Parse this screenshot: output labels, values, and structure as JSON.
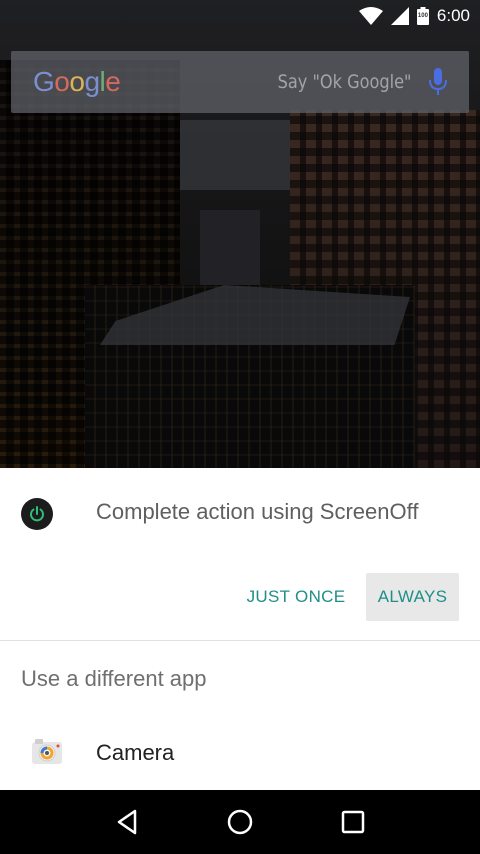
{
  "status_bar": {
    "time": "6:00",
    "battery_level": "100",
    "icons": [
      "wifi-icon",
      "cell-signal-icon",
      "battery-icon"
    ]
  },
  "search_widget": {
    "logo": "Google",
    "hint": "Say \"Ok Google\"",
    "icon": "microphone-icon"
  },
  "dialog": {
    "title": "Complete action using ScreenOff",
    "app_icon": "power-icon",
    "buttons": {
      "just_once": "JUST ONCE",
      "always": "ALWAYS"
    },
    "accent_color": "#1f8f88",
    "alternate_header": "Use a different app",
    "apps": [
      {
        "label": "Camera",
        "icon": "camera-app-icon"
      }
    ]
  },
  "nav_bar": {
    "buttons": [
      "back-icon",
      "home-icon",
      "recents-icon"
    ]
  }
}
